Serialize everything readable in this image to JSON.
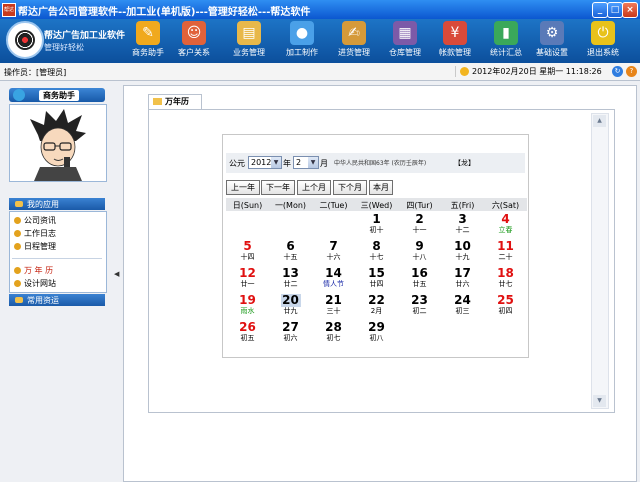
{
  "window": {
    "title": "帮达广告公司管理软件--加工业(单机版)---管理好轻松---帮达软件",
    "app_icon_text": "帮达",
    "minimize_label": "_",
    "maximize_label": "□",
    "close_label": "×"
  },
  "brand": {
    "name": "帮达广告加工业软件",
    "slogan": "管理好轻松"
  },
  "toolbar": [
    {
      "label": "商务助手",
      "icon": "pen-icon",
      "color": "#f0a91e"
    },
    {
      "label": "客户关系",
      "icon": "people-icon",
      "color": "#e0623a"
    },
    {
      "label": "业务管理",
      "icon": "clipboard-icon",
      "color": "#e8b84a"
    },
    {
      "label": "加工制作",
      "icon": "balls-icon",
      "color": "#4aa0e8"
    },
    {
      "label": "进货管理",
      "icon": "edit-icon",
      "color": "#d59a3a"
    },
    {
      "label": "仓库管理",
      "icon": "warehouse-icon",
      "color": "#7c5aa8"
    },
    {
      "label": "帐款管理",
      "icon": "money-icon",
      "color": "#d94a3a"
    },
    {
      "label": "统计汇总",
      "icon": "chart-icon",
      "color": "#3aa85a"
    },
    {
      "label": "基础设置",
      "icon": "settings-icon",
      "color": "#5a7ab8"
    },
    {
      "label": "退出系统",
      "icon": "exit-icon",
      "color": "#e8c21a"
    }
  ],
  "status": {
    "operator": "操作员：[管理员]",
    "datetime": "2012年02月20日  星期一  11:18:26"
  },
  "sidebar": {
    "panel_title": "商务助手",
    "my_apps": "我的应用",
    "apps": [
      "公司资讯",
      "工作日志",
      "日程管理"
    ],
    "apps2": [
      "万 年 历",
      "设计网站"
    ],
    "common": "常用资运"
  },
  "tab": {
    "label": "万年历"
  },
  "calendar": {
    "era_label": "公元",
    "year": "2012",
    "year_label": "年",
    "month": "2",
    "month_label": "月",
    "lunar_info": "中华人民共和国63年  (农历壬辰年)",
    "zodiac": "【龙】",
    "nav": [
      "上一年",
      "下一年",
      "上个月",
      "下个月",
      "本月"
    ],
    "weekdays": [
      "日(Sun)",
      "一(Mon)",
      "二(Tue)",
      "三(Wed)",
      "四(Tur)",
      "五(Fri)",
      "六(Sat)"
    ],
    "weeks": [
      [
        null,
        null,
        null,
        {
          "d": "1",
          "l": "初十"
        },
        {
          "d": "2",
          "l": "十一"
        },
        {
          "d": "3",
          "l": "十二"
        },
        {
          "d": "4",
          "l": "立春"
        }
      ],
      [
        {
          "d": "5",
          "l": "十四"
        },
        {
          "d": "6",
          "l": "十五"
        },
        {
          "d": "7",
          "l": "十六"
        },
        {
          "d": "8",
          "l": "十七"
        },
        {
          "d": "9",
          "l": "十八"
        },
        {
          "d": "10",
          "l": "十九"
        },
        {
          "d": "11",
          "l": "二十"
        }
      ],
      [
        {
          "d": "12",
          "l": "廿一"
        },
        {
          "d": "13",
          "l": "廿二"
        },
        {
          "d": "14",
          "l": "情人节"
        },
        {
          "d": "15",
          "l": "廿四"
        },
        {
          "d": "16",
          "l": "廿五"
        },
        {
          "d": "17",
          "l": "廿六"
        },
        {
          "d": "18",
          "l": "廿七"
        }
      ],
      [
        {
          "d": "19",
          "l": "雨水"
        },
        {
          "d": "20",
          "l": "廿九"
        },
        {
          "d": "21",
          "l": "三十"
        },
        {
          "d": "22",
          "l": "2月"
        },
        {
          "d": "23",
          "l": "初二"
        },
        {
          "d": "24",
          "l": "初三"
        },
        {
          "d": "25",
          "l": "初四"
        }
      ],
      [
        {
          "d": "26",
          "l": "初五"
        },
        {
          "d": "27",
          "l": "初六"
        },
        {
          "d": "28",
          "l": "初七"
        },
        {
          "d": "29",
          "l": "初八"
        },
        null,
        null,
        null
      ]
    ],
    "today": "20",
    "colors": {
      "weekend": "#e01010",
      "weekday": "#000000",
      "solar_term": "#1a9a1a",
      "festival": "#1a2aa8",
      "today_bg": "#c9d7ea"
    }
  }
}
